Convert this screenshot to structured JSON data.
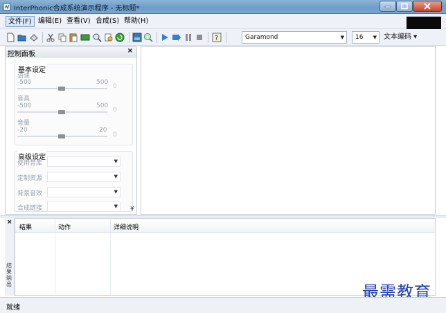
{
  "window": {
    "title": "InterPhonic合成系统演示程序 - 无标题*"
  },
  "menu": [
    {
      "label": "文件(F)",
      "active": true
    },
    {
      "label": "编辑(E)"
    },
    {
      "label": "查看(V)"
    },
    {
      "label": "合成(S)"
    },
    {
      "label": "帮助(H)"
    }
  ],
  "toolbar": {
    "font_name": "Garamond",
    "font_size": "16",
    "encoding_label": "文本编码 ▾",
    "icons": [
      "new-icon",
      "open-icon",
      "save-icon",
      "cut-icon",
      "copy-icon",
      "paste-icon",
      "select-all-icon",
      "find-icon",
      "replace-icon",
      "refresh-icon",
      "export-icon",
      "zoom-icon",
      "play-icon",
      "play-step-icon",
      "pause-icon",
      "stop-icon",
      "help-icon"
    ]
  },
  "panel": {
    "title": "控制面板",
    "basic": {
      "title": "基本设定",
      "rate": {
        "label": "语速",
        "min": "-500",
        "max": "500",
        "value": "0",
        "level": 0.5
      },
      "pitch": {
        "label": "音高",
        "min": "-500",
        "max": "500",
        "value": "0",
        "level": 0.5
      },
      "volume": {
        "label": "音量",
        "min": "-20",
        "max": "20",
        "value": "0",
        "level": 0.5
      }
    },
    "advanced": {
      "title": "高级设定",
      "fields": [
        {
          "label": "使用音库",
          "value": ""
        },
        {
          "label": "定制资源",
          "value": ""
        },
        {
          "label": "背景音效",
          "value": ""
        },
        {
          "label": "合成链接",
          "value": ""
        }
      ]
    }
  },
  "results": {
    "side_label": "结果输出",
    "columns": [
      "结果",
      "动作",
      "详细说明"
    ]
  },
  "status": {
    "text": "就绪"
  },
  "watermark": "最需教育",
  "colors": {
    "titlebar": "#7aa6cf",
    "watermark": "#1f3fb4"
  }
}
